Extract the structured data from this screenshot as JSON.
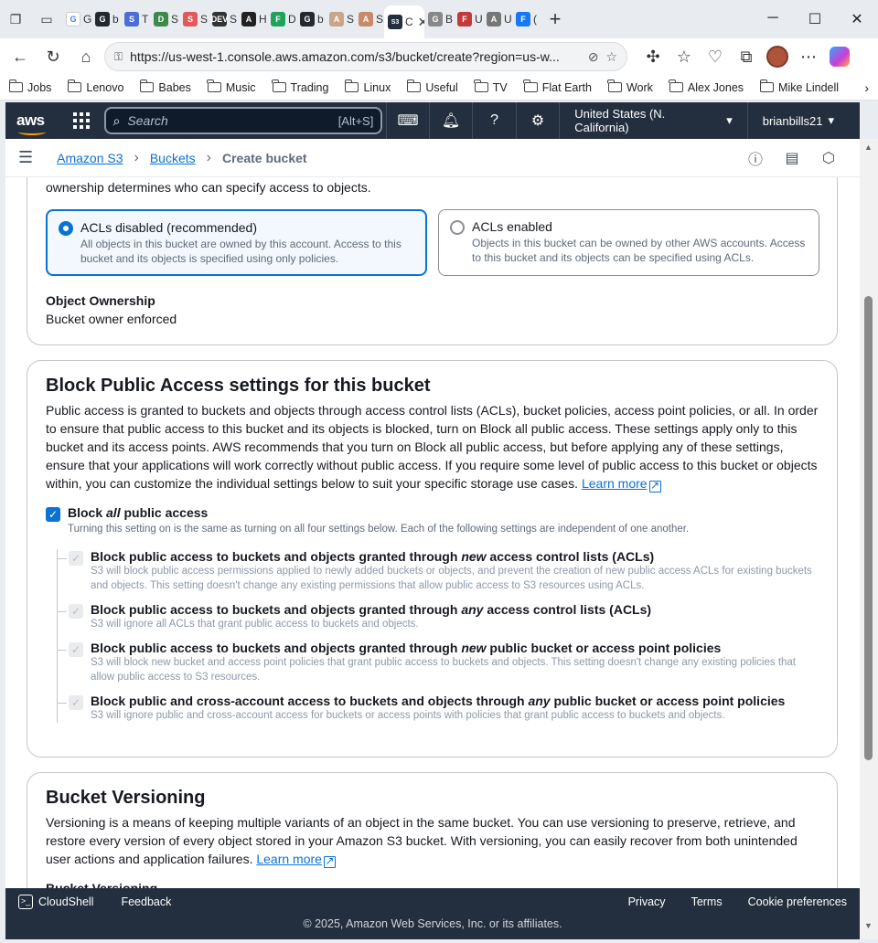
{
  "browser": {
    "tabs": [
      {
        "fav": "G",
        "color": "#ffffff",
        "text": "G"
      },
      {
        "fav": "gh",
        "color": "#24292f",
        "text": "b"
      },
      {
        "fav": "sh",
        "color": "#4a6fd1",
        "text": "T"
      },
      {
        "fav": "dl",
        "color": "#3c8a4a",
        "text": "S"
      },
      {
        "fav": "S",
        "color": "#e05a5a",
        "text": "S"
      },
      {
        "fav": "DEV",
        "color": "#333333",
        "text": "S"
      },
      {
        "fav": "ai",
        "color": "#222222",
        "text": "H"
      },
      {
        "fav": "fi",
        "color": "#1fa35b",
        "text": "D"
      },
      {
        "fav": "gh",
        "color": "#24292f",
        "text": "b"
      },
      {
        "fav": "av",
        "color": "#c9a58a",
        "text": "S"
      },
      {
        "fav": "av",
        "color": "#c98a6a",
        "text": "S"
      }
    ],
    "active_tab_text": "C",
    "tabs_after": [
      {
        "fav": "gl",
        "color": "#888888",
        "text": "B"
      },
      {
        "fav": "fl",
        "color": "#c23b3b",
        "text": "U"
      },
      {
        "fav": "av",
        "color": "#777777",
        "text": "U"
      },
      {
        "fav": "f",
        "color": "#1877f2",
        "text": "("
      }
    ],
    "url": "https://us-west-1.console.aws.amazon.com/s3/bucket/create?region=us-w...",
    "bookmarks": [
      "Jobs",
      "Lenovo",
      "Babes",
      "Music",
      "Trading",
      "Linux",
      "Useful",
      "TV",
      "Flat Earth",
      "Work",
      "Alex Jones",
      "Mike Lindell"
    ]
  },
  "aws_header": {
    "logo": "aws",
    "search_placeholder": "Search",
    "search_shortcut": "[Alt+S]",
    "region": "United States (N. California)",
    "account": "brianbills21"
  },
  "breadcrumb": {
    "items": [
      "Amazon S3",
      "Buckets"
    ],
    "current": "Create bucket"
  },
  "object_ownership": {
    "intro": "ownership determines who can specify access to objects.",
    "options": [
      {
        "title": "ACLs disabled (recommended)",
        "desc": "All objects in this bucket are owned by this account. Access to this bucket and its objects is specified using only policies.",
        "selected": true
      },
      {
        "title": "ACLs enabled",
        "desc": "Objects in this bucket can be owned by other AWS accounts. Access to this bucket and its objects can be specified using ACLs.",
        "selected": false
      }
    ],
    "label": "Object Ownership",
    "value": "Bucket owner enforced"
  },
  "block_public_access": {
    "title": "Block Public Access settings for this bucket",
    "description": "Public access is granted to buckets and objects through access control lists (ACLs), bucket policies, access point policies, or all. In order to ensure that public access to this bucket and its objects is blocked, turn on Block all public access. These settings apply only to this bucket and its access points. AWS recommends that you turn on Block all public access, but before applying any of these settings, ensure that your applications will work correctly without public access. If you require some level of public access to this bucket or objects within, you can customize the individual settings below to suit your specific storage use cases.",
    "learn_more": "Learn more",
    "block_all": {
      "pre": "Block ",
      "em": "all",
      "post": " public access",
      "desc": "Turning this setting on is the same as turning on all four settings below. Each of the following settings are independent of one another.",
      "checked": true
    },
    "settings": [
      {
        "pre": "Block public access to buckets and objects granted through ",
        "em": "new",
        "post": " access control lists (ACLs)",
        "desc": "S3 will block public access permissions applied to newly added buckets or objects, and prevent the creation of new public access ACLs for existing buckets and objects. This setting doesn't change any existing permissions that allow public access to S3 resources using ACLs."
      },
      {
        "pre": "Block public access to buckets and objects granted through ",
        "em": "any",
        "post": " access control lists (ACLs)",
        "desc": "S3 will ignore all ACLs that grant public access to buckets and objects."
      },
      {
        "pre": "Block public access to buckets and objects granted through ",
        "em": "new",
        "post": " public bucket or access point policies",
        "desc": "S3 will block new bucket and access point policies that grant public access to buckets and objects. This setting doesn't change any existing policies that allow public access to S3 resources."
      },
      {
        "pre": "Block public and cross-account access to buckets and objects through ",
        "em": "any",
        "post": " public bucket or access point policies",
        "desc": "S3 will ignore public and cross-account access for buckets or access points with policies that grant public access to buckets and objects."
      }
    ]
  },
  "versioning": {
    "title": "Bucket Versioning",
    "description": "Versioning is a means of keeping multiple variants of an object in the same bucket. You can use versioning to preserve, retrieve, and restore every version of every object stored in your Amazon S3 bucket. With versioning, you can easily recover from both unintended user actions and application failures.",
    "learn_more": "Learn more",
    "label": "Bucket Versioning"
  },
  "footer": {
    "cloudshell": "CloudShell",
    "feedback": "Feedback",
    "links": [
      "Privacy",
      "Terms",
      "Cookie preferences"
    ],
    "copyright": "© 2025, Amazon Web Services, Inc. or its affiliates."
  }
}
